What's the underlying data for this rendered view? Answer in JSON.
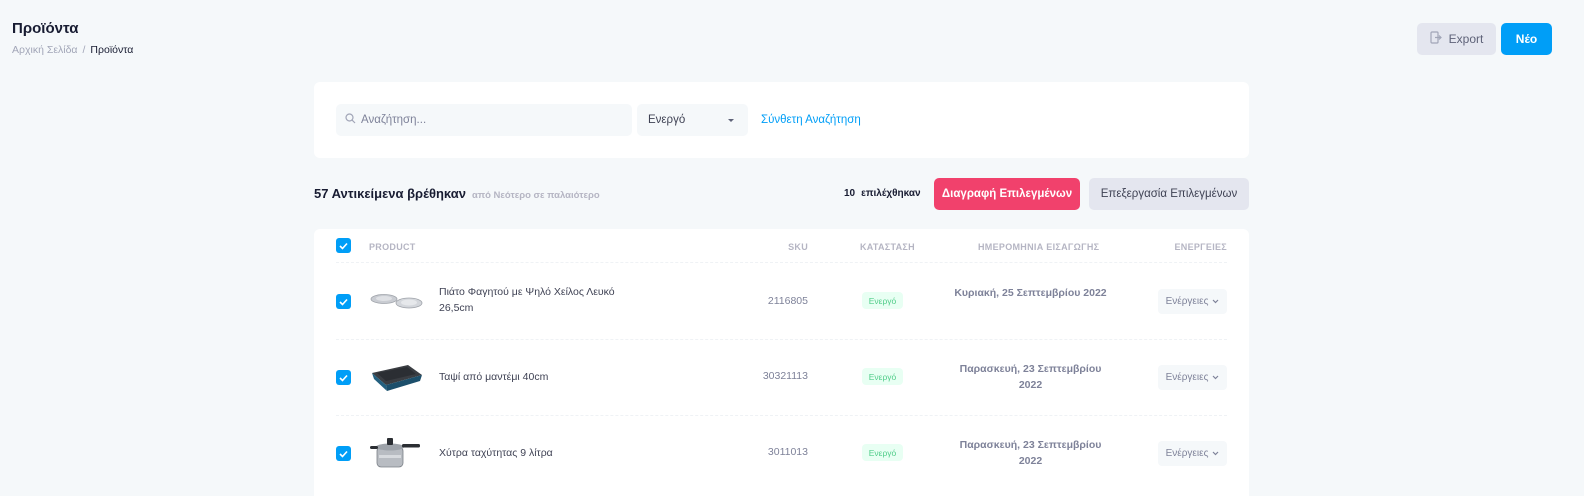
{
  "header": {
    "title": "Προϊόντα",
    "breadcrumb": {
      "home": "Αρχική Σελίδα",
      "separator": "/",
      "current": "Προϊόντα"
    },
    "export_label": "Export",
    "new_label": "Νέο"
  },
  "search": {
    "placeholder": "Αναζήτηση...",
    "status_value": "Ενεργό",
    "advanced_label": "Σύνθετη Αναζήτηση"
  },
  "results": {
    "count_text": "57 Αντικείμενα βρέθηκαν",
    "sort_text": "από Νεότερο σε παλαιότερο",
    "selected_count": "10",
    "selected_label": "επιλέχθηκαν",
    "delete_label": "Διαγραφή Επιλεγμένων",
    "edit_label": "Επεξεργασία Επιλεγμένων"
  },
  "table": {
    "columns": [
      "PRODUCT",
      "SKU",
      "ΚΑΤΑΣΤΑΣΗ",
      "ΗΜΕΡΟΜΗΝΙΑ ΕΙΣΑΓΩΓΗΣ",
      "ΕΝΕΡΓΕΙΕΣ"
    ],
    "rows": [
      {
        "name": "Πιάτο Φαγητού με Ψηλό Χείλος Λευκό 26,5cm",
        "sku": "2116805",
        "status": "Ενεργό",
        "date": "Κυριακή, 25 Σεπτεμβρίου 2022",
        "action": "Ενέργειες",
        "checked": true,
        "thumb": "plate"
      },
      {
        "name": "Ταψί από μαντέμι 40cm",
        "sku": "30321113",
        "status": "Ενεργό",
        "date": "Παρασκευή, 23 Σεπτεμβρίου 2022",
        "action": "Ενέργειες",
        "checked": true,
        "thumb": "baking-pan"
      },
      {
        "name": "Χύτρα ταχύτητας 9 λίτρα",
        "sku": "3011013",
        "status": "Ενεργό",
        "date": "Παρασκευή, 23 Σεπτεμβρίου 2022",
        "action": "Ενέργειες",
        "checked": true,
        "thumb": "pressure-cooker"
      }
    ]
  },
  "colors": {
    "primary": "#009ef7",
    "danger": "#f1416c",
    "success": "#50cd89",
    "background": "#f5f8fa"
  }
}
